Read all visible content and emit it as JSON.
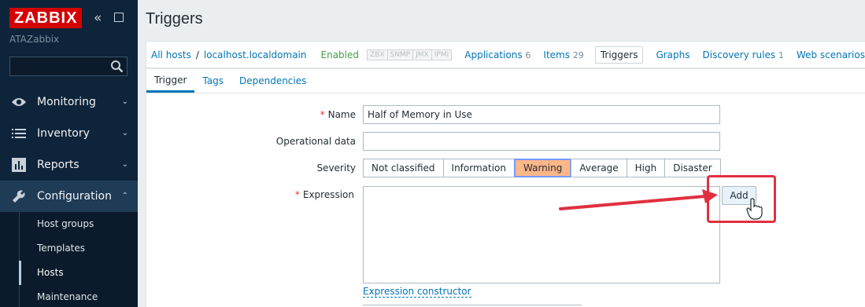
{
  "sidebar": {
    "logo": "ZABBIX",
    "collapse_icon": "double-chevron-left-icon",
    "kiosk_icon": "fullscreen-icon",
    "server_name": "ATAZabbix",
    "search": {
      "value": "",
      "placeholder": ""
    },
    "menu": [
      {
        "label": "Monitoring",
        "icon": "eye-icon",
        "expanded": false
      },
      {
        "label": "Inventory",
        "icon": "list-icon",
        "expanded": false
      },
      {
        "label": "Reports",
        "icon": "bar-chart-icon",
        "expanded": false
      },
      {
        "label": "Configuration",
        "icon": "wrench-icon",
        "expanded": true
      }
    ],
    "submenu": [
      {
        "label": "Host groups",
        "selected": false
      },
      {
        "label": "Templates",
        "selected": false
      },
      {
        "label": "Hosts",
        "selected": true
      },
      {
        "label": "Maintenance",
        "selected": false
      }
    ]
  },
  "page": {
    "title": "Triggers"
  },
  "host_nav": {
    "all_hosts": "All hosts",
    "separator": "/",
    "host": "localhost.localdomain",
    "status": "Enabled",
    "availability": [
      "ZBX",
      "SNMP",
      "JMX",
      "IPMI"
    ],
    "tabs": [
      {
        "label": "Applications",
        "count": "6"
      },
      {
        "label": "Items",
        "count": "29"
      },
      {
        "label": "Triggers",
        "count": ""
      },
      {
        "label": "Graphs",
        "count": ""
      },
      {
        "label": "Discovery rules",
        "count": "1"
      },
      {
        "label": "Web scenarios",
        "count": ""
      }
    ]
  },
  "form": {
    "tabs": [
      "Trigger",
      "Tags",
      "Dependencies"
    ],
    "name_label": "Name",
    "name_value": "Half of Memory in Use",
    "opdata_label": "Operational data",
    "opdata_value": "",
    "severity_label": "Severity",
    "severities": [
      "Not classified",
      "Information",
      "Warning",
      "Average",
      "High",
      "Disaster"
    ],
    "severity_selected": "Warning",
    "expression_label": "Expression",
    "expression_value": "",
    "add_button": "Add",
    "expression_constructor": "Expression constructor",
    "required_mark": "*"
  },
  "colors": {
    "accent": "#0275b8",
    "sidebar_bg": "#0d243b",
    "warning_bg": "#ffb689",
    "annotation_red": "#e03040"
  }
}
